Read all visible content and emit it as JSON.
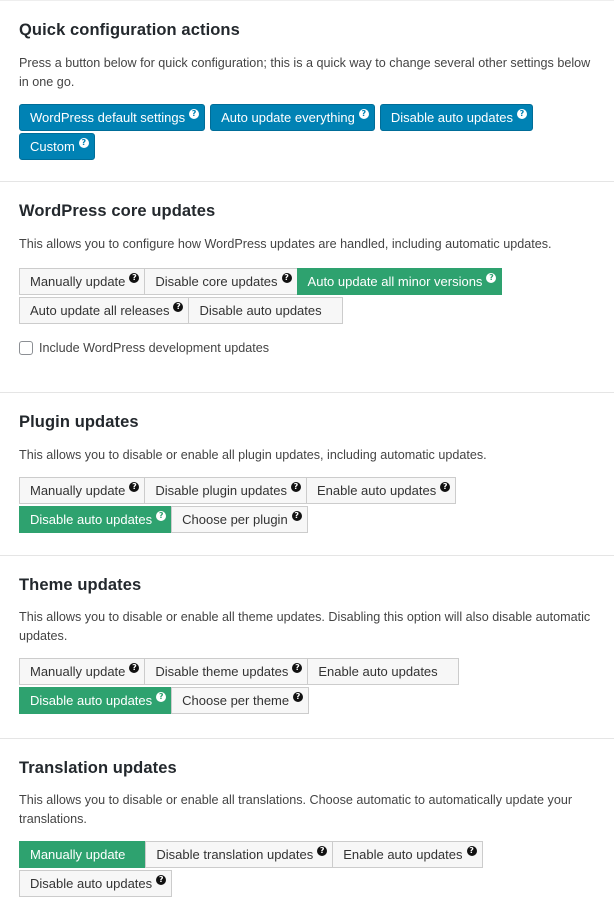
{
  "quick": {
    "title": "Quick configuration actions",
    "description": "Press a button below for quick configuration; this is a quick way to change several other settings below in one go.",
    "buttons": [
      "WordPress default settings",
      "Auto update everything",
      "Disable auto updates",
      "Custom"
    ]
  },
  "core": {
    "title": "WordPress core updates",
    "description": "This allows you to configure how WordPress updates are handled, including automatic updates.",
    "options": [
      "Manually update",
      "Disable core updates",
      "Auto update all minor versions",
      "Auto update all releases",
      "Disable auto updates"
    ],
    "active_option": "Auto update all minor versions",
    "checkbox_label": "Include WordPress development updates",
    "checkbox_checked": false
  },
  "plugin": {
    "title": "Plugin updates",
    "description": "This allows you to disable or enable all plugin updates, including automatic updates.",
    "options": [
      "Manually update",
      "Disable plugin updates",
      "Enable auto updates",
      "Disable auto updates",
      "Choose per plugin"
    ],
    "active_option": "Disable auto updates"
  },
  "theme": {
    "title": "Theme updates",
    "description": "This allows you to disable or enable all theme updates. Disabling this option will also disable automatic updates.",
    "options": [
      "Manually update",
      "Disable theme updates",
      "Enable auto updates",
      "Disable auto updates",
      "Choose per theme"
    ],
    "active_option": "Disable auto updates"
  },
  "translation": {
    "title": "Translation updates",
    "description": "This allows you to disable or enable all translations. Choose automatic to automatically update your translations.",
    "options": [
      "Manually update",
      "Disable translation updates",
      "Enable auto updates",
      "Disable auto updates"
    ],
    "active_option": "Manually update"
  },
  "help_icon_glyph": "?",
  "colors": {
    "active_green": "#2ea26f",
    "quick_blue": "#0082b4"
  }
}
